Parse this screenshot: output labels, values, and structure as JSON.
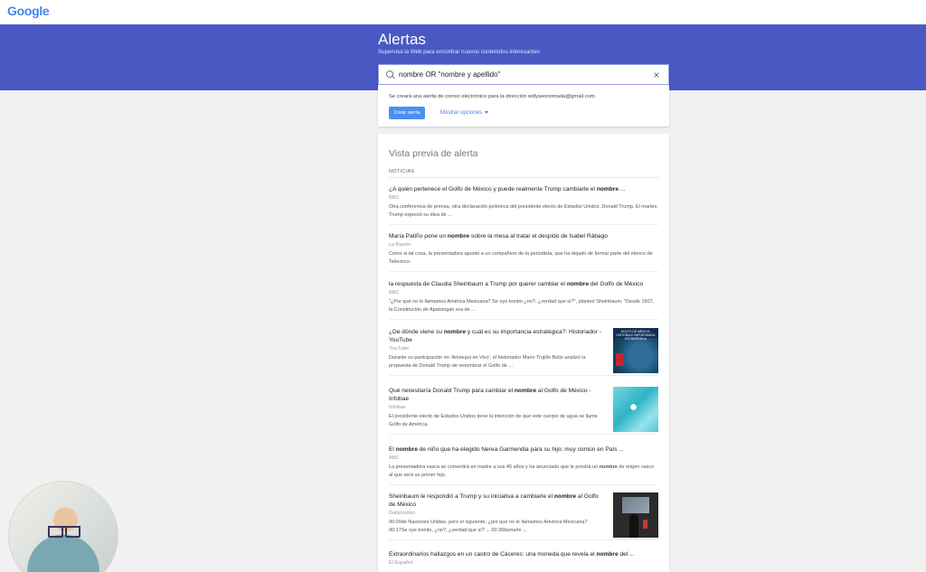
{
  "header": {
    "logo_text": "Google"
  },
  "banner": {
    "title": "Alertas",
    "subtitle": "Supervisa la Web para encontrar nuevos contenidos interesantes"
  },
  "search": {
    "value": "nombre OR \"nombre y apellido\""
  },
  "create_alert": {
    "info": "Se creará una alerta de correo electrónico para la dirección willyseonomada@gmail.com.",
    "button_label": "Crear alerta",
    "options_label": "Mostrar opciones"
  },
  "preview": {
    "title": "Vista previa de alerta",
    "section": "NOTICIAS",
    "items": [
      {
        "title_before": "¿A quién pertenece el Golfo de México y puede realmente Trump cambiarle el ",
        "title_bold": "nombre",
        "title_after": " ...",
        "source": "BBC",
        "snippet": "Otra conferencia de prensa, otra declaración polémica del presidente electo de Estados Unidos, Donald Trump. El martes, Trump expresó su idea de ..."
      },
      {
        "title_before": "María Patiño pone un ",
        "title_bold": "nombre",
        "title_after": " sobre la mesa al tratar el despido de Isabel Rábago",
        "source": "La Razón",
        "snippet": "Como si tal cosa, la presentadora apuntó a un compañero de la periodista, que ha dejado de formar parte del elenco de Telecinco."
      },
      {
        "title_before": "la respuesta de Claudia Sheinbaum a Trump por querer cambiar el ",
        "title_bold": "nombre",
        "title_after": " del Golfo de México",
        "source": "BBC",
        "snippet": "\"¿Por qué no le llamamos América Mexicana? Se oye bonito ¿no?, ¿verdad que sí?\", planteó Sheinbaum. \"Desde 1607, la Constitución de Apatzingán era de ..."
      },
      {
        "title_before": "¿De dónde viene su ",
        "title_bold": "nombre",
        "title_after": " y cuál es su importancia estratégica?: Historiador - YouTube",
        "source": "YouTube",
        "snippet": "Durante su participación en 'Aristegui en Vivo', el historiador Mario Trujillo Bolio analizó la propuesta de Donald Trump de renombrar el Golfo de ...",
        "thumb_text": "GOLFO DE MÉXICO: HISTORIA E IMPORTANCIA ESTRATÉGICA"
      },
      {
        "title_before": "Qué necesitaría Donald Trump para cambiar el ",
        "title_bold": "nombre",
        "title_after": " al Golfo de México - Infobae",
        "source": "Infobae",
        "snippet": "El presidente electo de Estados Unidos tiene la intención de que este cuerpo de agua se llame Golfo de América."
      },
      {
        "title_before": "El ",
        "title_bold": "nombre",
        "title_after": " de niño que ha elegido Nerea Garmendia para su hijo: muy común en País ...",
        "source": "ABC",
        "snippet_before": "La presentadora vasca se convertirá en madre a sus 45 años y ha anunciado que le pondrá un ",
        "snippet_bold": "nombre",
        "snippet_after": " de origen vasco al que será su primer hijo."
      },
      {
        "title_before": "Sheinbaum le respondió a Trump y su iniciativa a cambiarle el ",
        "title_bold": "nombre",
        "title_after": " al Golfo de México",
        "source": "Dailymotion",
        "snippet": "00:09de Naciones Unidas, pero el siguiente, ¿por qué no le llamamos América Mexicana? 00:17Se oye bonito, ¿no?, ¿verdad que sí? ... 00:36llamarle ..."
      },
      {
        "title_before": "Extraordinarios hallazgos en un castro de Cáceres: una moneda que revela el ",
        "title_bold": "nombre",
        "title_after": " del ...",
        "source": "El Español"
      }
    ]
  },
  "colors": {
    "banner": "#4a58c4",
    "button": "#4d8ff0",
    "link": "#4d7be8"
  },
  "icons": [
    "search-icon",
    "close-icon",
    "chevron-down-icon"
  ]
}
